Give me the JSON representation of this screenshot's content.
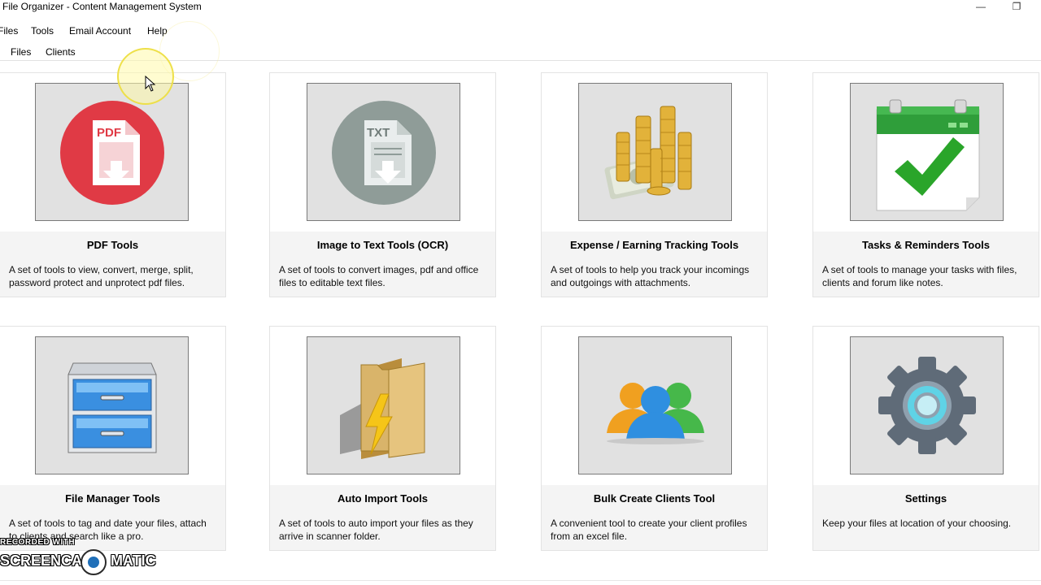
{
  "window": {
    "title": "File Organizer - Content Management System",
    "minimize_glyph": "—",
    "restore_glyph": "❐"
  },
  "menu": {
    "items": [
      "Files",
      "Tools",
      "Email Account",
      "Help"
    ]
  },
  "tabs": [
    "Files",
    "Clients"
  ],
  "cards": [
    {
      "title": "PDF Tools",
      "description": "A set of tools to view, convert, merge, split, password protect and unprotect pdf files.",
      "icon": "pdf-icon",
      "icon_label": "PDF"
    },
    {
      "title": "Image to Text Tools (OCR)",
      "description": "A set of tools to convert images, pdf and office files to editable text files.",
      "icon": "txt-icon",
      "icon_label": "TXT"
    },
    {
      "title": "Expense / Earning Tracking Tools",
      "description": "A set of tools to help you track your incomings and outgoings with attachments.",
      "icon": "coins-money-icon"
    },
    {
      "title": "Tasks & Reminders Tools",
      "description": "A set of tools to manage your tasks with files, clients and forum like notes.",
      "icon": "calendar-check-icon"
    },
    {
      "title": "File Manager Tools",
      "description": "A set of tools to tag and date your files, attach to clients and search like a pro.",
      "icon": "file-cabinet-icon"
    },
    {
      "title": "Auto Import Tools",
      "description": "A set of tools to auto import your files as they arrive in scanner folder.",
      "icon": "folder-lightning-icon"
    },
    {
      "title": "Bulk Create Clients Tool",
      "description": "A convenient tool to create your client profiles from an excel file.",
      "icon": "users-group-icon"
    },
    {
      "title": "Settings",
      "description": "Keep your files at location of your choosing.",
      "icon": "gear-icon"
    }
  ],
  "watermark": {
    "top_text": "RECORDED WITH",
    "left_text": "SCREENCAST",
    "right_text": "MATIC"
  },
  "colors": {
    "pdf_red": "#e03a45",
    "txt_gray": "#8f9c98",
    "calendar_green": "#2f9e3a",
    "check_green": "#2aa52a",
    "cabinet_blue": "#3a8fe0",
    "folder_tan": "#d9b46a",
    "bolt_yellow": "#f5c518",
    "gear_gray": "#5f6b78",
    "gear_ring": "#5fd3e6"
  }
}
